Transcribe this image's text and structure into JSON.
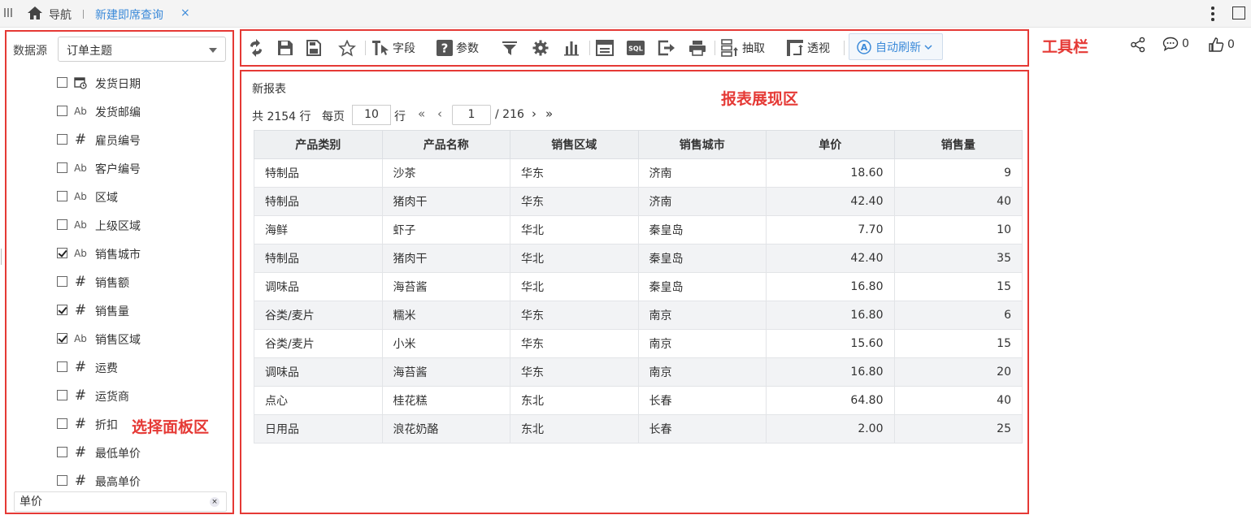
{
  "topbar": {
    "nav_label": "导航",
    "tab_label": "新建即席查询",
    "tab_close": "×"
  },
  "panel": {
    "datasource_label": "数据源",
    "datasource_value": "订单主题",
    "fields": [
      {
        "label": "发货日期",
        "type": "date",
        "checked": false
      },
      {
        "label": "发货邮编",
        "type": "text",
        "checked": false
      },
      {
        "label": "雇员编号",
        "type": "number",
        "checked": false
      },
      {
        "label": "客户编号",
        "type": "text",
        "checked": false
      },
      {
        "label": "区域",
        "type": "text",
        "checked": false
      },
      {
        "label": "上级区域",
        "type": "text",
        "checked": false
      },
      {
        "label": "销售城市",
        "type": "text",
        "checked": true
      },
      {
        "label": "销售额",
        "type": "number",
        "checked": false
      },
      {
        "label": "销售量",
        "type": "number",
        "checked": true
      },
      {
        "label": "销售区域",
        "type": "text",
        "checked": true
      },
      {
        "label": "运费",
        "type": "number",
        "checked": false
      },
      {
        "label": "运货商",
        "type": "number",
        "checked": false
      },
      {
        "label": "折扣",
        "type": "number",
        "checked": false
      },
      {
        "label": "最低单价",
        "type": "number",
        "checked": false
      },
      {
        "label": "最高单价",
        "type": "number",
        "checked": false
      }
    ],
    "text_icon": "Ab",
    "number_icon": "#",
    "search_value": "单价",
    "search_clear": "×",
    "annotation": "选择面板区"
  },
  "toolbar": {
    "field_label": "字段",
    "param_label": "参数",
    "extract_label": "抽取",
    "pivot_label": "透视",
    "auto_refresh_label": "自动刷新",
    "sql_text": "SQL",
    "annotation": "工具栏"
  },
  "actions": {
    "comment_count": "0",
    "like_count": "0"
  },
  "report": {
    "title": "新报表",
    "annotation": "报表展现区",
    "pager": {
      "total_text": "共 2154 行",
      "per_page_label": "每页",
      "page_size": "10",
      "row_label": "行",
      "current_page": "1",
      "of_text": "/ 216",
      "first": "«",
      "prev": "‹",
      "next": "›",
      "last": "»"
    },
    "columns": [
      "产品类别",
      "产品名称",
      "销售区域",
      "销售城市",
      "单价",
      "销售量"
    ],
    "rows": [
      [
        "特制品",
        "沙茶",
        "华东",
        "济南",
        "18.60",
        "9"
      ],
      [
        "特制品",
        "猪肉干",
        "华东",
        "济南",
        "42.40",
        "40"
      ],
      [
        "海鲜",
        "虾子",
        "华北",
        "秦皇岛",
        "7.70",
        "10"
      ],
      [
        "特制品",
        "猪肉干",
        "华北",
        "秦皇岛",
        "42.40",
        "35"
      ],
      [
        "调味品",
        "海苔酱",
        "华北",
        "秦皇岛",
        "16.80",
        "15"
      ],
      [
        "谷类/麦片",
        "糯米",
        "华东",
        "南京",
        "16.80",
        "6"
      ],
      [
        "谷类/麦片",
        "小米",
        "华东",
        "南京",
        "15.60",
        "15"
      ],
      [
        "调味品",
        "海苔酱",
        "华东",
        "南京",
        "16.80",
        "20"
      ],
      [
        "点心",
        "桂花糕",
        "东北",
        "长春",
        "64.80",
        "40"
      ],
      [
        "日用品",
        "浪花奶酪",
        "东北",
        "长春",
        "2.00",
        "25"
      ]
    ]
  },
  "colors": {
    "annotation_red": "#e53935",
    "accent_blue": "#3b8ad9",
    "header_bg": "#eef0f2",
    "row_alt_bg": "#f2f3f5"
  }
}
